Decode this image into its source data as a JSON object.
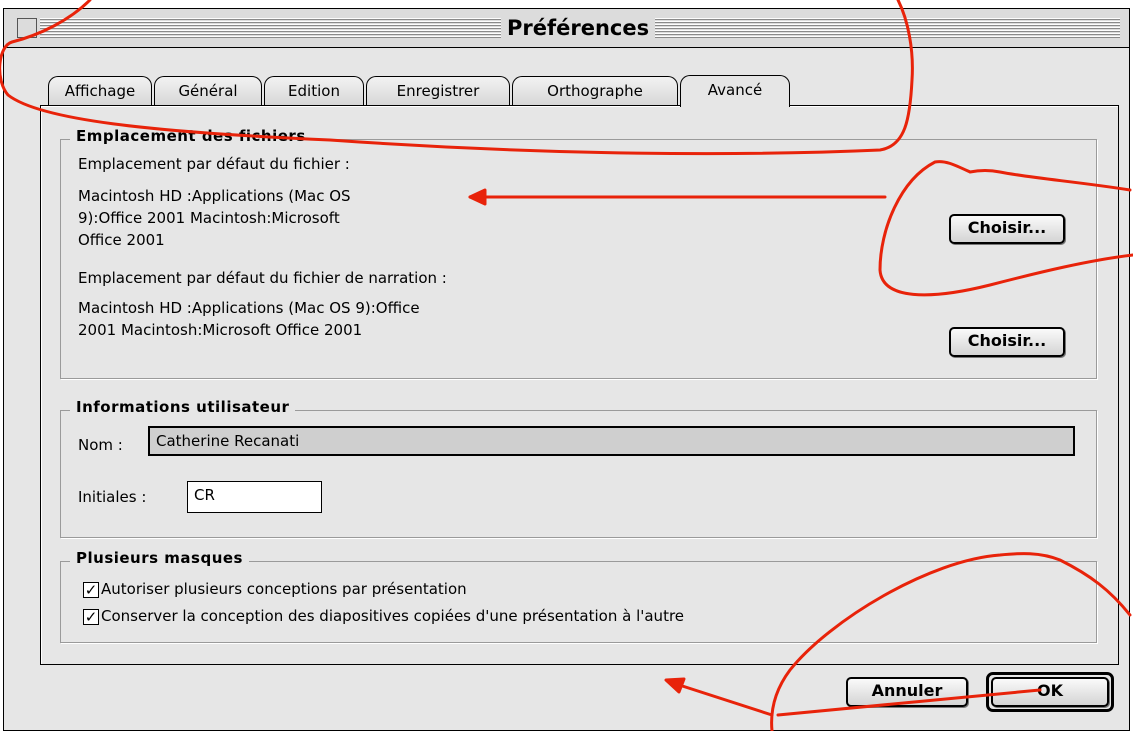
{
  "window": {
    "title": "Préférences"
  },
  "tabs": [
    {
      "label": "Affichage"
    },
    {
      "label": "Général"
    },
    {
      "label": "Edition"
    },
    {
      "label": "Enregistrer"
    },
    {
      "label": "Orthographe"
    },
    {
      "label": "Avancé",
      "active": true
    }
  ],
  "file_locations": {
    "heading": "Emplacement des fichiers",
    "default_file_label": "Emplacement par défaut du fichier  :",
    "default_file_path_line1": "Macintosh HD :Applications (Mac OS",
    "default_file_path_line2": "9):Office 2001 Macintosh:Microsoft",
    "default_file_path_line3": "Office 2001",
    "choose1_label": "Choisir...",
    "narration_label": "Emplacement par défaut du fichier de narration  :",
    "narration_path_line1": "Macintosh HD :Applications (Mac OS 9):Office",
    "narration_path_line2": "2001 Macintosh:Microsoft Office 2001",
    "choose2_label": "Choisir..."
  },
  "user_info": {
    "heading": "Informations utilisateur",
    "name_label": "Nom  :",
    "name_value": "Catherine Recanati",
    "initials_label": "Initiales  :",
    "initials_value": "CR"
  },
  "multiple_masters": {
    "heading": "Plusieurs masques",
    "options": [
      {
        "label": "Autoriser plusieurs conceptions par présentation",
        "checked": true
      },
      {
        "label": "Conserver la conception des diapositives copiées d'une présentation à l'autre",
        "checked": true
      }
    ]
  },
  "footer": {
    "cancel_label": "Annuler",
    "ok_label": "OK"
  },
  "colors": {
    "annotation": "#e8230a",
    "window_bg": "#e6e6e6"
  }
}
